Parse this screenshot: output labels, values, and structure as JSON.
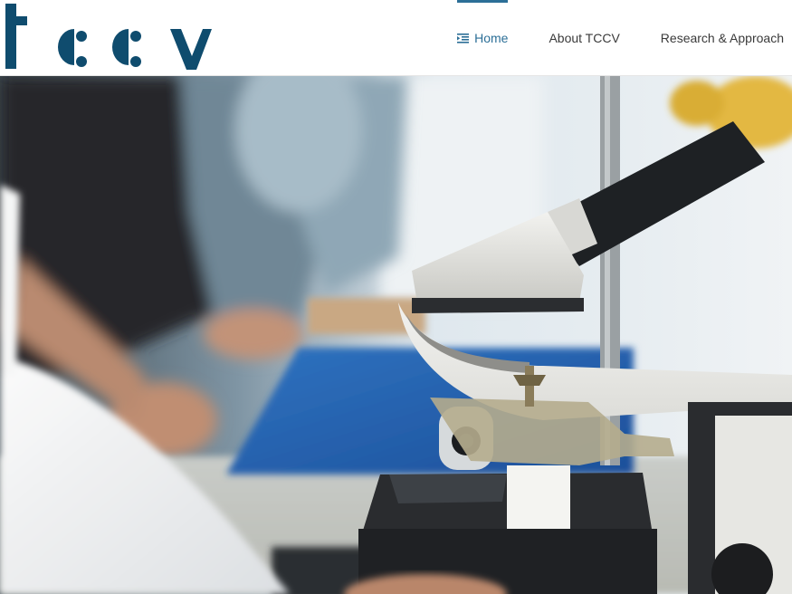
{
  "brand": {
    "logo_text": "tccv",
    "logo_color": "#0f4c6e"
  },
  "nav": {
    "items": [
      {
        "label": "Home",
        "icon": "home-list-icon",
        "active": true
      },
      {
        "label": "About TCCV",
        "active": false
      },
      {
        "label": "Research & Approach",
        "active": false
      }
    ],
    "active_color": "#2c6f97",
    "text_color": "#3a3a3a"
  },
  "hero": {
    "image": "laboratory-microscope-photo"
  }
}
